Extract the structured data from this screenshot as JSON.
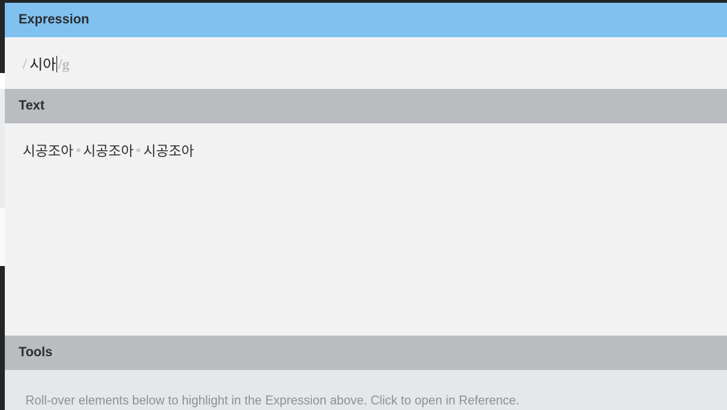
{
  "expression": {
    "header": "Expression",
    "open_delimiter": "/",
    "pattern": "시아",
    "close_delimiter": "/",
    "flags": "g"
  },
  "text": {
    "header": "Text",
    "words": [
      "시공조아",
      "시공조아",
      "시공조아"
    ]
  },
  "tools": {
    "header": "Tools",
    "hint": "Roll-over elements below to highlight in the Expression above. Click to open in Reference."
  }
}
